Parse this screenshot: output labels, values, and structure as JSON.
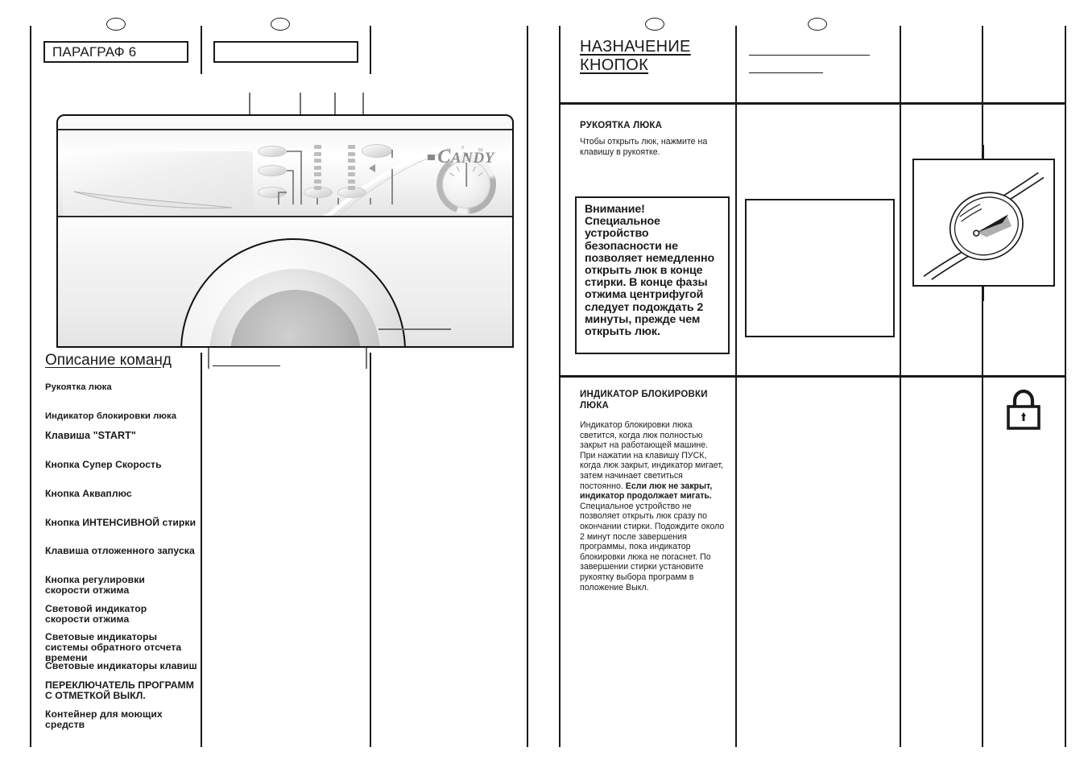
{
  "left_page": {
    "chapter_label": "ПАРАГРАФ 6",
    "commands_heading": "Описание команд",
    "commands": [
      "Рукоятка люка",
      "Индикатор блокировки люка",
      "Клавиша \"START\"",
      "Кнопка Супер Скорость",
      "Кнопка Акваплюс",
      "Кнопка ИНТЕНСИВНОЙ стирки",
      "Клавиша отложенного запуска",
      "Кнопка регулировки скорости отжима",
      "Световой индикатор скорости отжима",
      "Световые индикаторы системы обратного отсчета времени",
      "Световые индикаторы клавиш",
      "ПЕРЕКЛЮЧАТЕЛЬ ПРОГРАММ С ОТМЕТКОЙ ВЫКЛ.",
      "Контейнер для моющих средств"
    ],
    "machine": {
      "brand_initial": "C",
      "brand_rest": "ANDY",
      "knob_labels": [
        "40",
        "0",
        "50"
      ]
    }
  },
  "right_page": {
    "heading_line1": "НАЗНАЧЕНИЕ",
    "heading_line2": "КНОПОК",
    "sections": [
      {
        "title": "РУКОЯТКА  ЛЮКА",
        "body": "Чтобы открыть люк, нажмите на клавишу в рукоятке.",
        "warning": "Внимание! Специальное устройство безопасности не позволяет немедленно открыть люк в конце стирки. В конце фазы отжима центрифугой следует подождать 2 минуты, прежде чем открыть люк.",
        "illustration": "door-handle-press-diagram"
      },
      {
        "title_line1": "ИНДИКАТОР БЛОКИРОВКИ",
        "title_line2": "ЛЮКА",
        "body_part1": "Индикатор блокировки люка светится, когда люк полностью закрыт на работающей машине. При нажатии на клавишу ПУСК, когда люк закрыт, индикатор мигает, затем начинает светиться постоянно.",
        "body_bold": "Если люк не закрыт, индикатор продолжает мигать.",
        "body_part2": "Специальное устройство не позволяет открыть люк сразу по окончании стирки. Подождите около 2 минут после завершения программы, пока индикатор блокировки люка не погаснет. По завершении стирки установите рукоятку выбора программ в положение Выкл.",
        "icon": "padlock-icon"
      }
    ]
  },
  "colors": {
    "ink": "#1a1a1a",
    "leader": "#6f6f6f",
    "page_bg": "#ffffff"
  }
}
